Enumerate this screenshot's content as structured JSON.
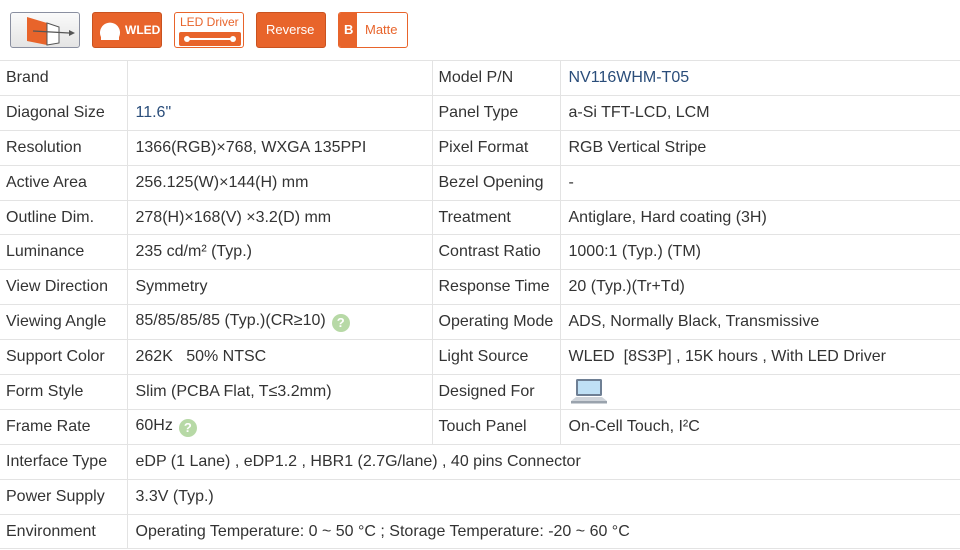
{
  "badges": {
    "wled": "WLED",
    "led_driver": "LED Driver",
    "reverse": "Reverse",
    "matte": "Matte",
    "matte_letter": "B"
  },
  "specs": {
    "brand_label": "Brand",
    "brand_value": "",
    "model_label": "Model P/N",
    "model_value": "NV116WHM-T05",
    "diagonal_label": "Diagonal Size",
    "diagonal_value": "11.6\"",
    "panel_type_label": "Panel Type",
    "panel_type_value": "a-Si TFT-LCD, LCM",
    "resolution_label": "Resolution",
    "resolution_value": "1366(RGB)×768, WXGA  135PPI",
    "pixel_format_label": "Pixel Format",
    "pixel_format_value": "RGB Vertical Stripe",
    "active_area_label": "Active Area",
    "active_area_value": "256.125(W)×144(H) mm",
    "bezel_label": "Bezel Opening",
    "bezel_value": "-",
    "outline_label": "Outline Dim.",
    "outline_value": "278(H)×168(V) ×3.2(D) mm",
    "treatment_label": "Treatment",
    "treatment_value": "Antiglare, Hard coating (3H)",
    "luminance_label": "Luminance",
    "luminance_value": "235 cd/m² (Typ.)",
    "contrast_label": "Contrast Ratio",
    "contrast_value": "1000:1 (Typ.) (TM)",
    "view_dir_label": "View Direction",
    "view_dir_value": "Symmetry",
    "response_label": "Response Time",
    "response_value": "20 (Typ.)(Tr+Td)",
    "viewing_angle_label": "Viewing Angle",
    "viewing_angle_value": "85/85/85/85 (Typ.)(CR≥10)",
    "op_mode_label": "Operating Mode",
    "op_mode_value": "ADS, Normally Black, Transmissive",
    "support_color_label": "Support Color",
    "support_color_value": "262K   50% NTSC",
    "light_source_label": "Light Source",
    "light_source_value": "WLED  [8S3P] , 15K hours , With LED Driver",
    "form_style_label": "Form Style",
    "form_style_value": "Slim (PCBA Flat, T≤3.2mm)",
    "designed_for_label": "Designed For",
    "frame_rate_label": "Frame Rate",
    "frame_rate_value": "60Hz",
    "touch_label": "Touch Panel",
    "touch_value": "On-Cell Touch, I²C",
    "interface_label": "Interface Type",
    "interface_value": "eDP (1 Lane) , eDP1.2 , HBR1 (2.7G/lane) , 40 pins Connector",
    "power_label": "Power Supply",
    "power_value": "3.3V (Typ.)",
    "env_label": "Environment",
    "env_value": "Operating Temperature: 0 ~ 50 °C ; Storage Temperature: -20 ~ 60 °C"
  },
  "help_glyph": "?",
  "icons": {
    "panel": "panel-angle-icon",
    "wled": "bulb-icon",
    "led_driver": "driver-connector-icon",
    "laptop": "laptop-icon",
    "help": "question-icon"
  },
  "colors": {
    "accent": "#e8642b",
    "link": "#2a4d7a",
    "help": "#b7d9a6"
  }
}
